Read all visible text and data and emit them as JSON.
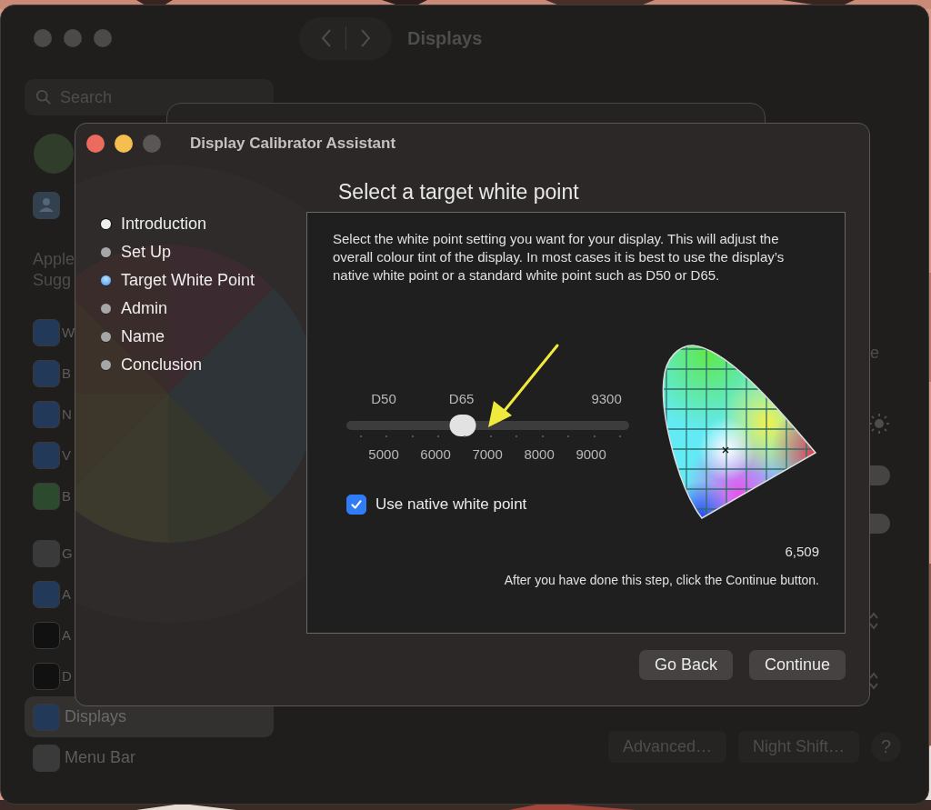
{
  "settings_window": {
    "title": "Displays",
    "search": {
      "placeholder": "Search"
    },
    "sidebar": {
      "account_lines": [
        "Apple",
        "Sugg"
      ],
      "items": [
        {
          "label": "W",
          "selected": false,
          "color": "#22395a"
        },
        {
          "label": "B",
          "selected": false,
          "color": "#22395a"
        },
        {
          "label": "N",
          "selected": false,
          "color": "#22395a"
        },
        {
          "label": "V",
          "selected": false,
          "color": "#22395a"
        },
        {
          "label": "B",
          "selected": false,
          "color": "#2c4a2e"
        },
        {
          "label": "G",
          "selected": false,
          "color": "#3a3a3a"
        },
        {
          "label": "A",
          "selected": false,
          "color": "#22395a"
        },
        {
          "label": "A",
          "selected": false,
          "color": "#111111"
        },
        {
          "label": "D",
          "selected": false,
          "color": "#111111"
        },
        {
          "label": "Displays",
          "selected": true,
          "color": "#22395a"
        },
        {
          "label": "Menu Bar",
          "selected": false,
          "color": "#3a3a3a"
        }
      ]
    },
    "partial_label": "e",
    "toggles": [
      {
        "on": false
      },
      {
        "on": false
      }
    ],
    "buttons": [
      "Advanced…",
      "Night Shift…"
    ],
    "help": "?"
  },
  "dialog": {
    "title": "Display Calibrator Assistant",
    "heading": "Select a target white point",
    "steps": [
      {
        "label": "Introduction",
        "selected": false,
        "visited": true
      },
      {
        "label": "Set Up",
        "selected": false,
        "visited": false
      },
      {
        "label": "Target White Point",
        "selected": true,
        "visited": false
      },
      {
        "label": "Admin",
        "selected": false,
        "visited": false
      },
      {
        "label": "Name",
        "selected": false,
        "visited": false
      },
      {
        "label": "Conclusion",
        "selected": false,
        "visited": false
      }
    ],
    "description": "Select the white point setting you want for your display. This will adjust the overall colour tint of the display. In most cases it is best to use the display’s native white point or a standard white point such as D50 or D65.",
    "slider": {
      "top_labels": [
        "D50",
        "D65",
        "9300"
      ],
      "scale_labels": [
        "5000",
        "6000",
        "7000",
        "8000",
        "9000"
      ],
      "level": 0.412
    },
    "checkbox": {
      "label": "Use native white point",
      "checked": true
    },
    "reading": "6,509",
    "instruction": "After you have done this step, click the Continue button.",
    "buttons": [
      {
        "label": "Go Back"
      },
      {
        "label": "Continue"
      }
    ]
  }
}
